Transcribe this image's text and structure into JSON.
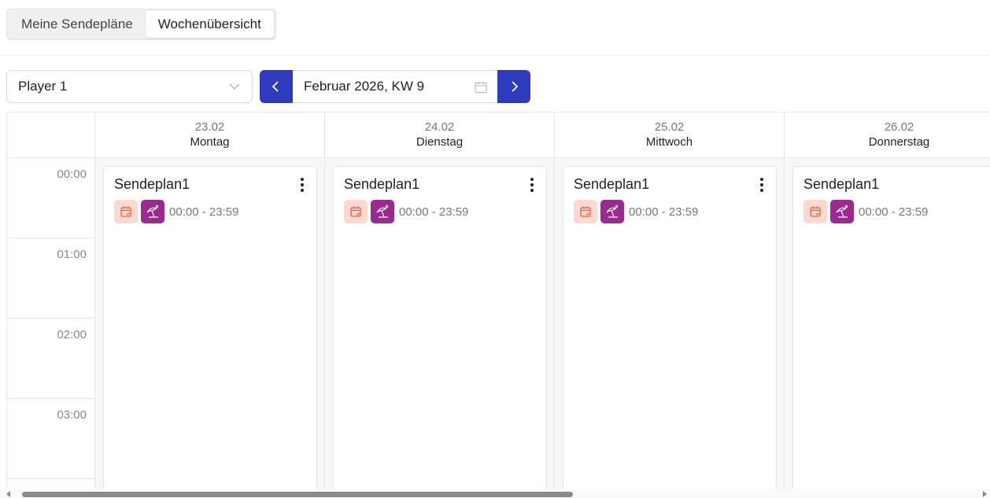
{
  "tabs": [
    {
      "label": "Meine Sendepläne",
      "active": false
    },
    {
      "label": "Wochenübersicht",
      "active": true
    }
  ],
  "player_select": {
    "value": "Player 1"
  },
  "week_nav": {
    "label": "Februar 2026, KW 9"
  },
  "time_slots": [
    "00:00",
    "01:00",
    "02:00",
    "03:00"
  ],
  "days": [
    {
      "date": "23.02",
      "name": "Montag"
    },
    {
      "date": "24.02",
      "name": "Dienstag"
    },
    {
      "date": "25.02",
      "name": "Mittwoch"
    },
    {
      "date": "26.02",
      "name": "Donnerstag"
    }
  ],
  "schedules": [
    {
      "title": "Sendeplan1",
      "time": "00:00 - 23:59"
    },
    {
      "title": "Sendeplan1",
      "time": "00:00 - 23:59"
    },
    {
      "title": "Sendeplan1",
      "time": "00:00 - 23:59"
    },
    {
      "title": "Sendeplan1",
      "time": "00:00 - 23:59"
    }
  ],
  "icons": {
    "select_chevron": "chevron-down-icon",
    "prev": "chevron-left-icon",
    "next": "chevron-right-icon",
    "calendar": "calendar-icon",
    "schedule_badge": "calendar-check-icon",
    "holiday_badge": "beach-umbrella-icon",
    "card_menu": "more-vertical-icon"
  },
  "colors": {
    "accent": "#2f3bbd",
    "calendar_badge_bg": "#fbd9d0",
    "calendar_badge_fg": "#e8643f",
    "holiday_badge_bg": "#9b2a8f"
  }
}
